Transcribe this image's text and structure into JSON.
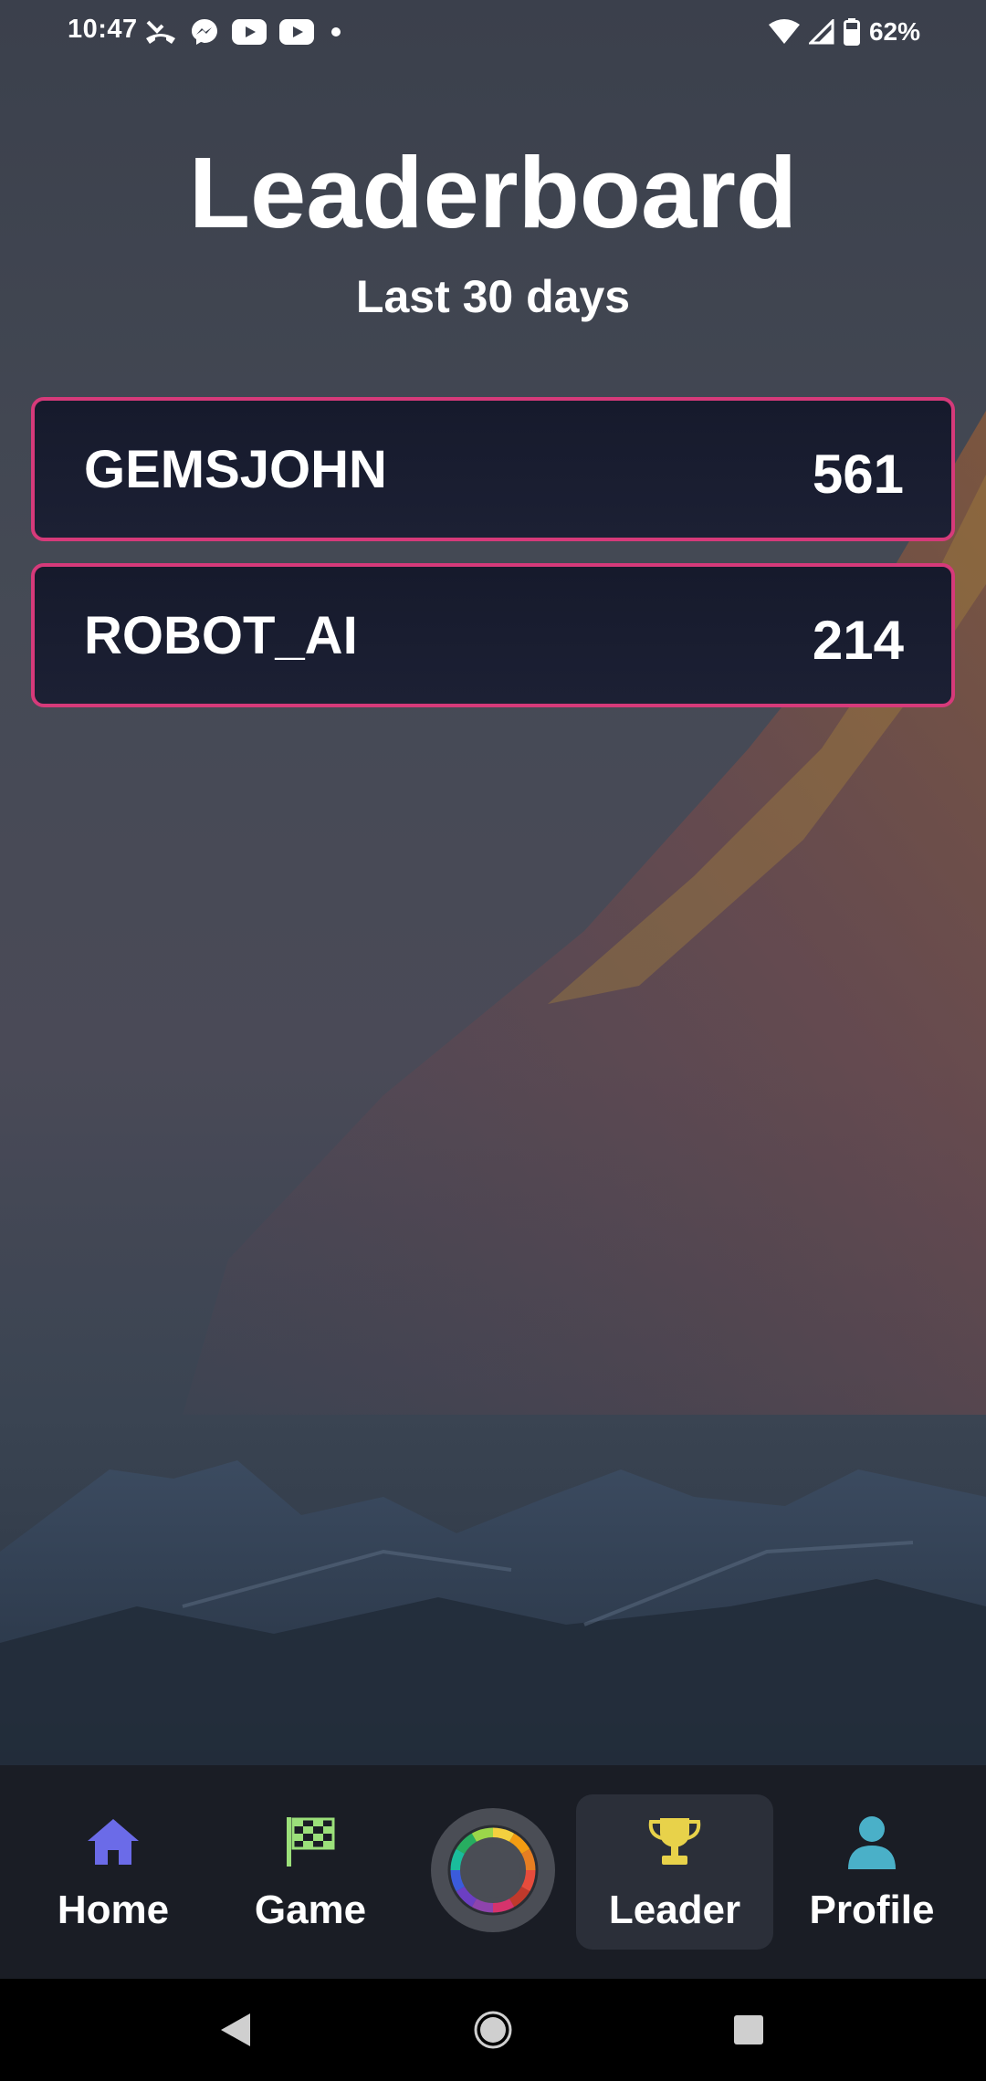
{
  "status_bar": {
    "time": "10:47",
    "battery_percent": "62%",
    "icons_left": [
      "missed-call-icon",
      "messenger-icon",
      "youtube-icon",
      "youtube-icon",
      "dot-icon"
    ],
    "icons_right": [
      "wifi-icon",
      "cell-signal-icon",
      "battery-icon"
    ]
  },
  "header": {
    "title": "Leaderboard",
    "subtitle": "Last 30 days"
  },
  "leaderboard": [
    {
      "name": "GEMSJOHN",
      "score": "561"
    },
    {
      "name": "ROBOT_AI",
      "score": "214"
    }
  ],
  "bottom_nav": {
    "items": [
      {
        "label": "Home",
        "icon": "home-icon",
        "color": "#6b6be8"
      },
      {
        "label": "Game",
        "icon": "checkered-flag-icon",
        "color": "#9be07a"
      },
      {
        "label": "",
        "icon": "color-wheel-icon",
        "color": "#4a4d55"
      },
      {
        "label": "Leader",
        "icon": "trophy-icon",
        "color": "#e8d24a",
        "active": true
      },
      {
        "label": "Profile",
        "icon": "person-icon",
        "color": "#4ab0c8"
      }
    ]
  },
  "colors": {
    "row_border": "#d63a7a",
    "row_background": "#181c2e",
    "nav_background": "#1a1d25",
    "active_tab_background": "#2b2f39"
  }
}
